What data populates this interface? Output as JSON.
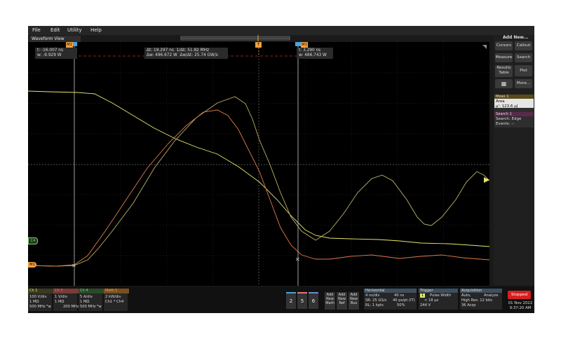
{
  "menu": [
    "File",
    "Edit",
    "Utility",
    "Help"
  ],
  "waveform_view": {
    "title": "Waveform View"
  },
  "cursors": {
    "m1_tag": "M1",
    "c1": {
      "t": "t: -16.007 ns",
      "w": "w: -9.929 W"
    },
    "delta": {
      "dt": "Δt: 19.297 ns",
      "inv_dt": "1/Δt: 51.82 MHz",
      "dw": "Δw: 496.672 W",
      "dw_dt": "Δw/Δt: 25.74 GW/s"
    },
    "c2": {
      "t": "t: 3.290 ns",
      "w": "w: 486.743 W"
    }
  },
  "trigger_marker": "T",
  "channel_markers": {
    "c4": "C4",
    "m1": "M1"
  },
  "right_panel": {
    "add_new": "Add New...",
    "buttons": [
      "Cursors",
      "Callout",
      "Measure",
      "Search",
      "Results Table",
      "Plot",
      "More..."
    ],
    "meas1": {
      "title": "Meas 1",
      "name": "Area",
      "value": "μ': 123.6 μJ"
    },
    "search1": {
      "title": "Search 1",
      "type": "Search: Edge",
      "events": "Events: --"
    }
  },
  "channels": [
    {
      "label": "Ch 1",
      "color": "#e7e76a",
      "l1": "100 V/div",
      "l2": "1 MΩ",
      "l3": "500 MHz ᴮw"
    },
    {
      "label": "Ch 3",
      "color": "#e07a7a",
      "l1": "1 V/div",
      "l2": "1 MΩ",
      "l3": "200 MHz ᴮw"
    },
    {
      "label": "Ch 4",
      "color": "#7fd27f",
      "l1": "5 A/div",
      "l2": "1 MΩ",
      "l3": "500 MHz ᴮw"
    },
    {
      "label": "Math 1",
      "color": "#f0a040",
      "l1": "2 kW/div",
      "l2": "Ch1 * Ch4",
      "l3": ""
    }
  ],
  "num_buttons": [
    "2",
    "5",
    "6"
  ],
  "add_buttons": [
    {
      "l1": "Add",
      "l2": "New",
      "l3": "Math"
    },
    {
      "l1": "Add",
      "l2": "New",
      "l3": "Ref"
    },
    {
      "l1": "Add",
      "l2": "New",
      "l3": "Bus"
    }
  ],
  "horizontal": {
    "title": "Horizontal",
    "a1": "4 ns/div",
    "a2": "40 ns",
    "b1": "SR: 25 GS/s",
    "b2": "40 ps/pt (IT)",
    "c1": "RL: 1 kpts",
    "c2": "50%"
  },
  "trigger": {
    "title": "Trigger",
    "ch": "1",
    "type": "Pulse Width",
    "cond": "< 18 μs",
    "level": "244 V"
  },
  "acquisition": {
    "title": "Acquisition",
    "a1": "Auto,",
    "a2": "Analyze",
    "b1": "High Res: 12 bits",
    "c1": "36 Acqs"
  },
  "status": {
    "state": "Stopped",
    "date": "01 Nov 2022",
    "time": "9:37:20 AM"
  },
  "colors": {
    "ch1": "#e7e76a",
    "ch3": "#e07a7a",
    "ch4": "#7fd27f",
    "math1": "#f0a040",
    "cursor": "#c8c8c8",
    "stopped": "#d42020"
  }
}
